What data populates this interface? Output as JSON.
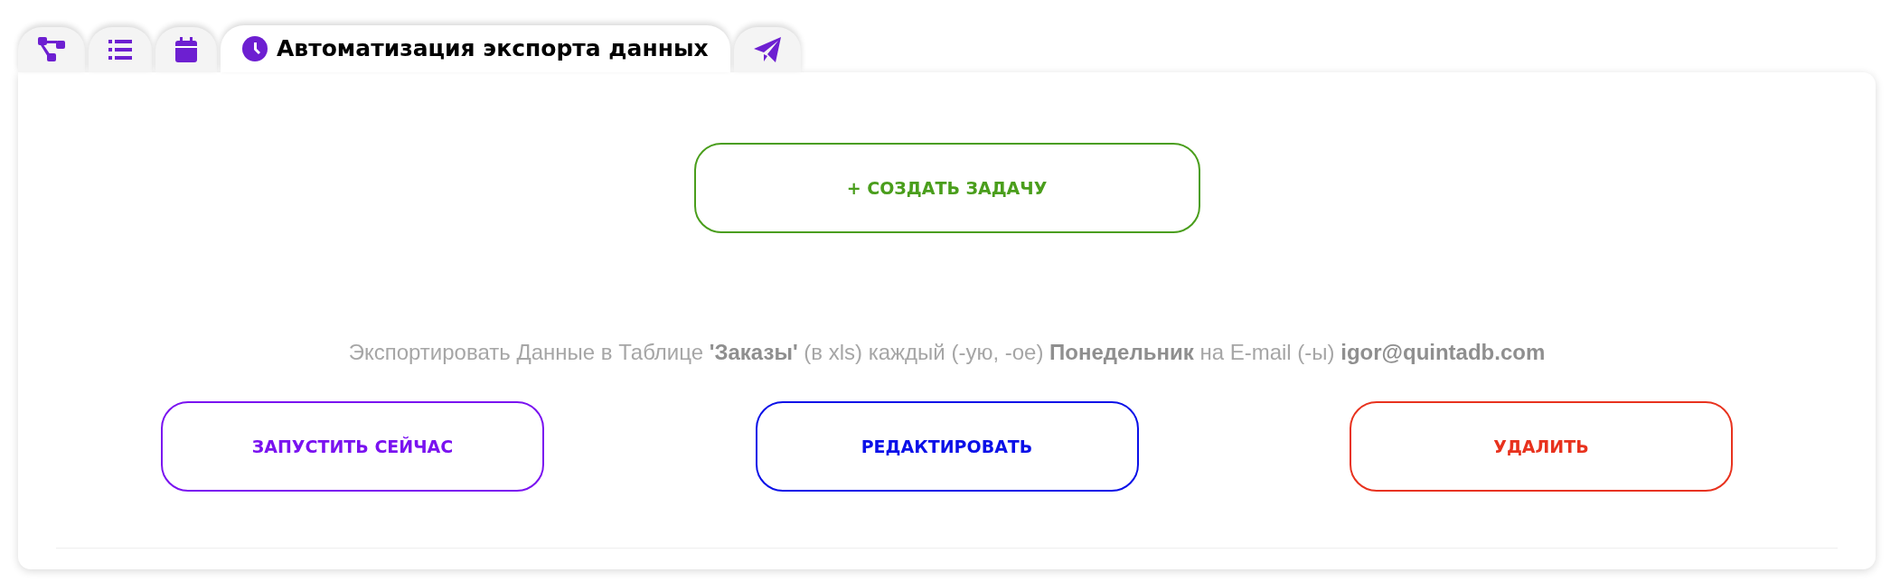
{
  "tabs": [
    {
      "kind": "diagram",
      "selected": false
    },
    {
      "kind": "list",
      "selected": false
    },
    {
      "kind": "calendar",
      "selected": false
    },
    {
      "kind": "clock",
      "label": "Автоматизация экспорта данных",
      "selected": true
    },
    {
      "kind": "send",
      "selected": false
    }
  ],
  "create_button": {
    "label": "+ СОЗДАТЬ ЗАДАЧУ",
    "color": "#4a9e1c"
  },
  "task": {
    "description": "Экспортировать Данные в Таблице **'Заказы'** (в xls) каждый (-ую, -ое) **Понедельник** на E-mail (-ы) **igor@quintadb.com**",
    "actions": [
      {
        "label": "ЗАПУСТИТЬ СЕЙЧАС",
        "color": "#7a12f0"
      },
      {
        "label": "РЕДАКТИРОВАТЬ",
        "color": "#0a10e8"
      },
      {
        "label": "УДАЛИТЬ",
        "color": "#e8321e"
      }
    ]
  }
}
